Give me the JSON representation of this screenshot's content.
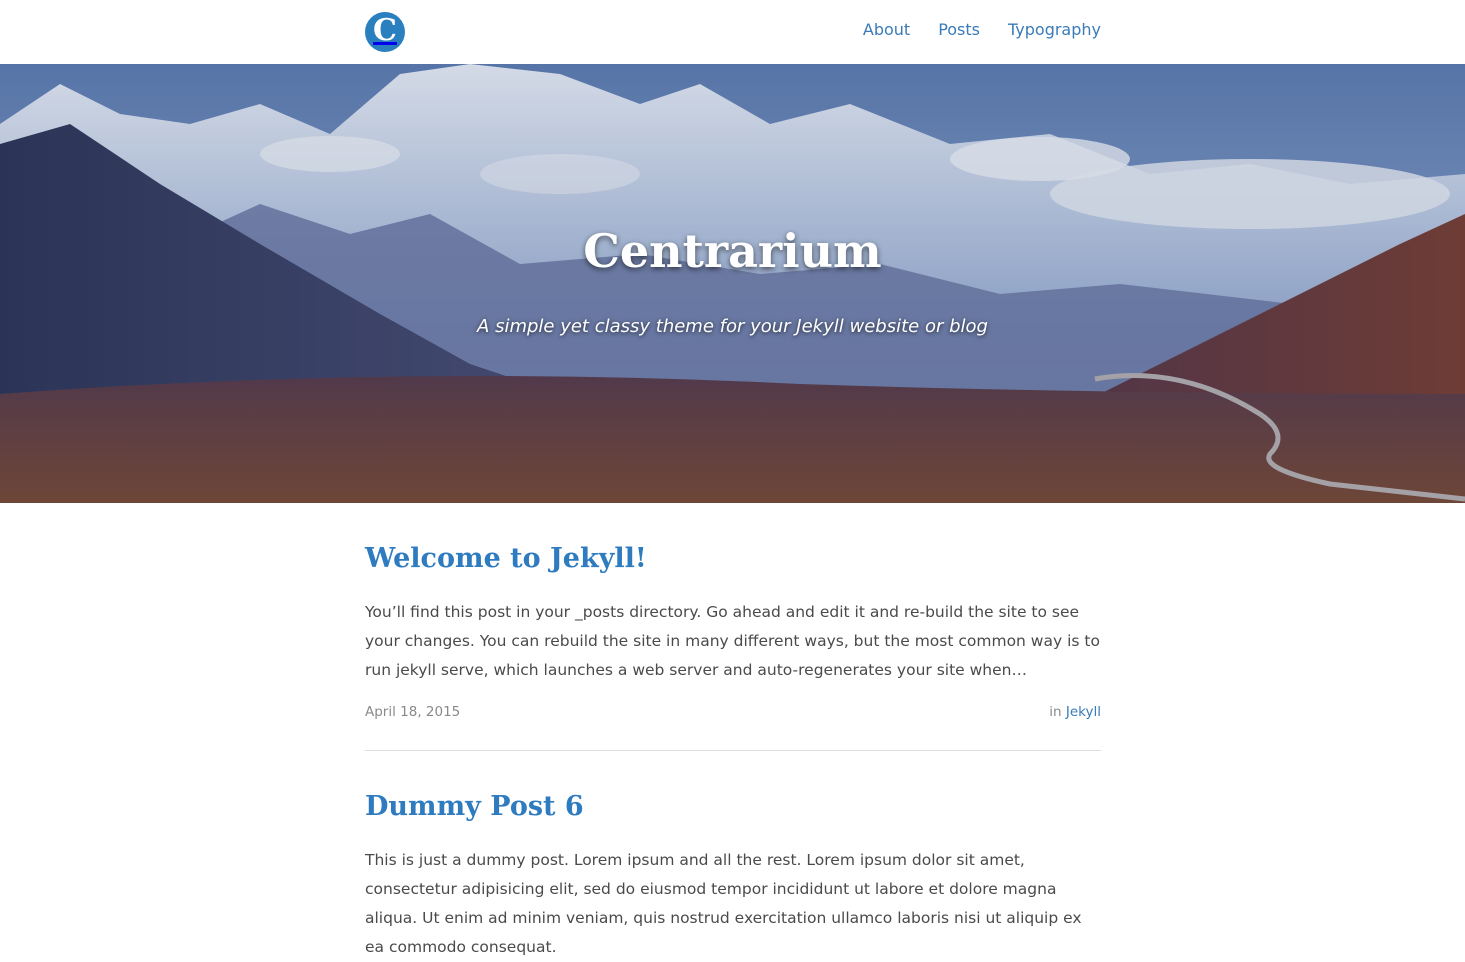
{
  "header": {
    "logo_letter": "C",
    "nav": [
      {
        "label": "About"
      },
      {
        "label": "Posts"
      },
      {
        "label": "Typography"
      }
    ]
  },
  "hero": {
    "title": "Centrarium",
    "tagline": "A simple yet classy theme for your Jekyll website or blog"
  },
  "posts": [
    {
      "title": "Welcome to Jekyll!",
      "excerpt": "You’ll find this post in your _posts directory. Go ahead and edit it and re-build the site to see your changes. You can rebuild the site in many different ways, but the most common way is to run jekyll serve, which launches a web server and auto-regenerates your site when…",
      "date": "April 18, 2015",
      "category_prefix": "in",
      "category": "Jekyll"
    },
    {
      "title": "Dummy Post 6",
      "excerpt": "This is just a dummy post. Lorem ipsum and all the rest. Lorem ipsum dolor sit amet, consectetur adipisicing elit, sed do eiusmod tempor incididunt ut labore et dolore magna aliqua. Ut enim ad minim veniam, quis nostrud exercitation ullamco laboris nisi ut aliquip ex ea commodo consequat."
    }
  ],
  "colors": {
    "accent": "#2f7bbf",
    "logo_bg": "#2a7fbf"
  }
}
